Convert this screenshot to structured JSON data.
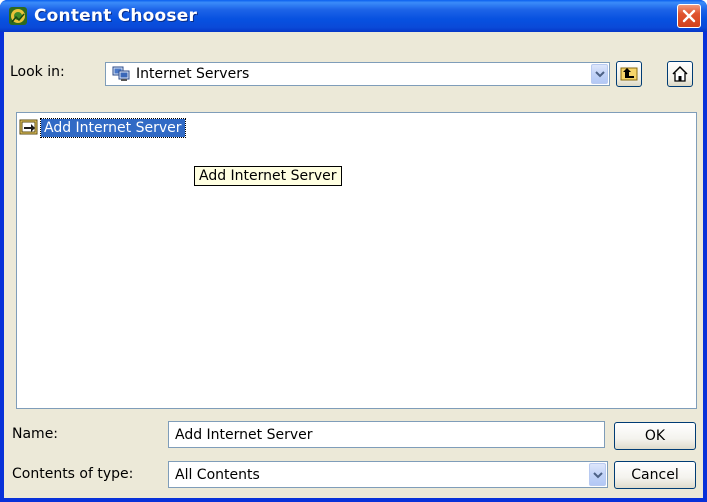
{
  "window": {
    "title": "Content Chooser",
    "icon": "content-chooser-icon",
    "close_icon": "close-icon"
  },
  "look_in": {
    "label": "Look in:",
    "value": "Internet Servers",
    "value_icon": "internet-servers-icon"
  },
  "toolbar": {
    "up_icon": "up-one-level-icon",
    "home_icon": "home-icon"
  },
  "list": {
    "items": [
      {
        "label": "Add Internet Server",
        "icon": "add-server-icon",
        "selected": true
      }
    ]
  },
  "tooltip": {
    "text": "Add Internet Server"
  },
  "name_field": {
    "label": "Name:",
    "value": "Add Internet Server"
  },
  "type_field": {
    "label": "Contents of type:",
    "value": "All Contents"
  },
  "buttons": {
    "ok": "OK",
    "cancel": "Cancel"
  },
  "colors": {
    "title_bar": "#0a4ad8",
    "dialog_face": "#ece9d8",
    "selection": "#316ac5",
    "tooltip_bg": "#ffffe1",
    "close_button": "#d2411c"
  }
}
